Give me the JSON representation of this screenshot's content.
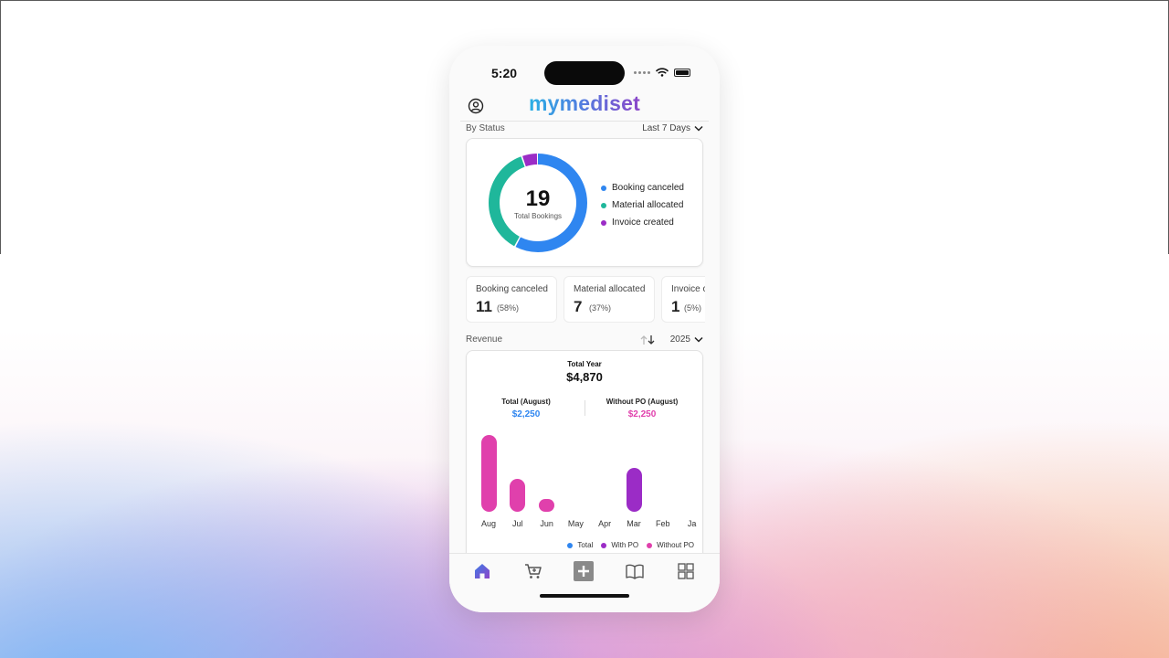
{
  "status_bar": {
    "time": "5:20"
  },
  "app": {
    "logo": "mymediset"
  },
  "by_status": {
    "label": "By Status",
    "range_selector": "Last 7 Days",
    "total": "19",
    "total_label": "Total Bookings",
    "legend": [
      {
        "label": "Booking canceled",
        "color": "#2f86f0"
      },
      {
        "label": "Material allocated",
        "color": "#1fb79b"
      },
      {
        "label": "Invoice created",
        "color": "#9b2cc6"
      }
    ],
    "segments": [
      {
        "label": "Booking canceled",
        "count": 11,
        "color": "#2f86f0"
      },
      {
        "label": "Material allocated",
        "count": 7,
        "color": "#1fb79b"
      },
      {
        "label": "Invoice created",
        "count": 1,
        "color": "#9b2cc6"
      }
    ]
  },
  "stat_cards": [
    {
      "title": "Booking canceled",
      "value": "11",
      "pct": "(58%)"
    },
    {
      "title": "Material allocated",
      "value": "7",
      "pct": "(37%)"
    },
    {
      "title": "Invoice created",
      "value": "1",
      "pct": "(5%)"
    }
  ],
  "revenue": {
    "label": "Revenue",
    "year_selector": "2025",
    "total_year_label": "Total Year",
    "total_year_value": "$4,870",
    "total_month_label": "Total (August)",
    "total_month_value": "$2,250",
    "without_po_label": "Without PO (August)",
    "without_po_value": "$2,250",
    "legend": [
      {
        "label": "Total",
        "color": "#2f86f0"
      },
      {
        "label": "With PO",
        "color": "#9b2cc6"
      },
      {
        "label": "Without PO",
        "color": "#e040ac"
      }
    ]
  },
  "chart_data": {
    "type": "bar",
    "categories": [
      "Aug",
      "Jul",
      "Jun",
      "May",
      "Apr",
      "Mar",
      "Feb",
      "Ja"
    ],
    "series": [
      {
        "name": "Total",
        "values": [
          0,
          0,
          0,
          0,
          0,
          0,
          0,
          0
        ]
      },
      {
        "name": "With PO",
        "values": [
          0,
          0,
          0,
          0,
          0,
          1280,
          0,
          0
        ]
      },
      {
        "name": "Without PO",
        "values": [
          2250,
          960,
          380,
          0,
          0,
          0,
          0,
          0
        ]
      }
    ]
  },
  "tabs": [
    {
      "name": "home",
      "icon": "home-icon"
    },
    {
      "name": "shop",
      "icon": "cart-icon"
    },
    {
      "name": "add",
      "icon": "plus-icon"
    },
    {
      "name": "catalog",
      "icon": "book-icon"
    },
    {
      "name": "apps",
      "icon": "grid-icon"
    }
  ]
}
